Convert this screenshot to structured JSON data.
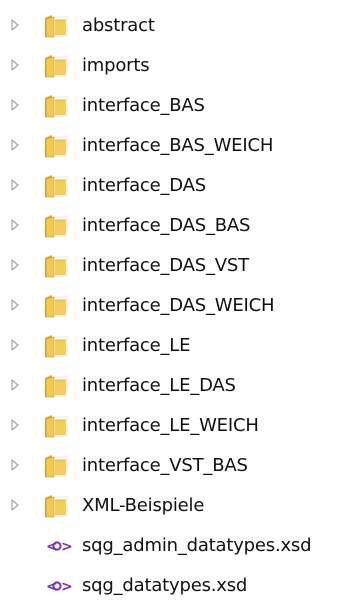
{
  "tree": {
    "items": [
      {
        "type": "folder",
        "label": "abstract",
        "icon": "folder-icon",
        "expander": "expand-arrow-icon"
      },
      {
        "type": "folder",
        "label": "imports",
        "icon": "folder-icon",
        "expander": "expand-arrow-icon"
      },
      {
        "type": "folder",
        "label": "interface_BAS",
        "icon": "folder-icon",
        "expander": "expand-arrow-icon"
      },
      {
        "type": "folder",
        "label": "interface_BAS_WEICH",
        "icon": "folder-icon",
        "expander": "expand-arrow-icon"
      },
      {
        "type": "folder",
        "label": "interface_DAS",
        "icon": "folder-icon",
        "expander": "expand-arrow-icon"
      },
      {
        "type": "folder",
        "label": "interface_DAS_BAS",
        "icon": "folder-icon",
        "expander": "expand-arrow-icon"
      },
      {
        "type": "folder",
        "label": "interface_DAS_VST",
        "icon": "folder-icon",
        "expander": "expand-arrow-icon"
      },
      {
        "type": "folder",
        "label": "interface_DAS_WEICH",
        "icon": "folder-icon",
        "expander": "expand-arrow-icon"
      },
      {
        "type": "folder",
        "label": "interface_LE",
        "icon": "folder-icon",
        "expander": "expand-arrow-icon"
      },
      {
        "type": "folder",
        "label": "interface_LE_DAS",
        "icon": "folder-icon",
        "expander": "expand-arrow-icon"
      },
      {
        "type": "folder",
        "label": "interface_LE_WEICH",
        "icon": "folder-icon",
        "expander": "expand-arrow-icon"
      },
      {
        "type": "folder",
        "label": "interface_VST_BAS",
        "icon": "folder-icon",
        "expander": "expand-arrow-icon"
      },
      {
        "type": "folder",
        "label": "XML-Beispiele",
        "icon": "folder-icon",
        "expander": "expand-arrow-icon"
      },
      {
        "type": "file",
        "label": "sqg_admin_datatypes.xsd",
        "icon": "xml-file-icon"
      },
      {
        "type": "file",
        "label": "sqg_datatypes.xsd",
        "icon": "xml-file-icon"
      }
    ]
  },
  "colors": {
    "folder_front": "#f3c94f",
    "folder_back": "#d9a52a",
    "folder_paper": "#ffffff",
    "expander": "#a6a6a6",
    "xml_icon": "#7b2fc0"
  }
}
